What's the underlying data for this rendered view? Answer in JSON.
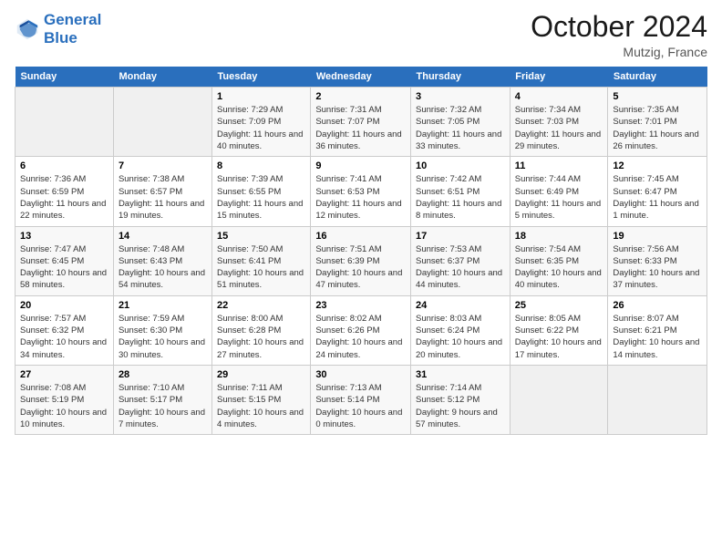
{
  "logo": {
    "line1": "General",
    "line2": "Blue"
  },
  "header": {
    "month": "October 2024",
    "location": "Mutzig, France"
  },
  "columns": [
    "Sunday",
    "Monday",
    "Tuesday",
    "Wednesday",
    "Thursday",
    "Friday",
    "Saturday"
  ],
  "weeks": [
    [
      {
        "day": "",
        "empty": true
      },
      {
        "day": "",
        "empty": true
      },
      {
        "day": "1",
        "sunrise": "7:29 AM",
        "sunset": "7:09 PM",
        "daylight": "11 hours and 40 minutes."
      },
      {
        "day": "2",
        "sunrise": "7:31 AM",
        "sunset": "7:07 PM",
        "daylight": "11 hours and 36 minutes."
      },
      {
        "day": "3",
        "sunrise": "7:32 AM",
        "sunset": "7:05 PM",
        "daylight": "11 hours and 33 minutes."
      },
      {
        "day": "4",
        "sunrise": "7:34 AM",
        "sunset": "7:03 PM",
        "daylight": "11 hours and 29 minutes."
      },
      {
        "day": "5",
        "sunrise": "7:35 AM",
        "sunset": "7:01 PM",
        "daylight": "11 hours and 26 minutes."
      }
    ],
    [
      {
        "day": "6",
        "sunrise": "7:36 AM",
        "sunset": "6:59 PM",
        "daylight": "11 hours and 22 minutes."
      },
      {
        "day": "7",
        "sunrise": "7:38 AM",
        "sunset": "6:57 PM",
        "daylight": "11 hours and 19 minutes."
      },
      {
        "day": "8",
        "sunrise": "7:39 AM",
        "sunset": "6:55 PM",
        "daylight": "11 hours and 15 minutes."
      },
      {
        "day": "9",
        "sunrise": "7:41 AM",
        "sunset": "6:53 PM",
        "daylight": "11 hours and 12 minutes."
      },
      {
        "day": "10",
        "sunrise": "7:42 AM",
        "sunset": "6:51 PM",
        "daylight": "11 hours and 8 minutes."
      },
      {
        "day": "11",
        "sunrise": "7:44 AM",
        "sunset": "6:49 PM",
        "daylight": "11 hours and 5 minutes."
      },
      {
        "day": "12",
        "sunrise": "7:45 AM",
        "sunset": "6:47 PM",
        "daylight": "11 hours and 1 minute."
      }
    ],
    [
      {
        "day": "13",
        "sunrise": "7:47 AM",
        "sunset": "6:45 PM",
        "daylight": "10 hours and 58 minutes."
      },
      {
        "day": "14",
        "sunrise": "7:48 AM",
        "sunset": "6:43 PM",
        "daylight": "10 hours and 54 minutes."
      },
      {
        "day": "15",
        "sunrise": "7:50 AM",
        "sunset": "6:41 PM",
        "daylight": "10 hours and 51 minutes."
      },
      {
        "day": "16",
        "sunrise": "7:51 AM",
        "sunset": "6:39 PM",
        "daylight": "10 hours and 47 minutes."
      },
      {
        "day": "17",
        "sunrise": "7:53 AM",
        "sunset": "6:37 PM",
        "daylight": "10 hours and 44 minutes."
      },
      {
        "day": "18",
        "sunrise": "7:54 AM",
        "sunset": "6:35 PM",
        "daylight": "10 hours and 40 minutes."
      },
      {
        "day": "19",
        "sunrise": "7:56 AM",
        "sunset": "6:33 PM",
        "daylight": "10 hours and 37 minutes."
      }
    ],
    [
      {
        "day": "20",
        "sunrise": "7:57 AM",
        "sunset": "6:32 PM",
        "daylight": "10 hours and 34 minutes."
      },
      {
        "day": "21",
        "sunrise": "7:59 AM",
        "sunset": "6:30 PM",
        "daylight": "10 hours and 30 minutes."
      },
      {
        "day": "22",
        "sunrise": "8:00 AM",
        "sunset": "6:28 PM",
        "daylight": "10 hours and 27 minutes."
      },
      {
        "day": "23",
        "sunrise": "8:02 AM",
        "sunset": "6:26 PM",
        "daylight": "10 hours and 24 minutes."
      },
      {
        "day": "24",
        "sunrise": "8:03 AM",
        "sunset": "6:24 PM",
        "daylight": "10 hours and 20 minutes."
      },
      {
        "day": "25",
        "sunrise": "8:05 AM",
        "sunset": "6:22 PM",
        "daylight": "10 hours and 17 minutes."
      },
      {
        "day": "26",
        "sunrise": "8:07 AM",
        "sunset": "6:21 PM",
        "daylight": "10 hours and 14 minutes."
      }
    ],
    [
      {
        "day": "27",
        "sunrise": "7:08 AM",
        "sunset": "5:19 PM",
        "daylight": "10 hours and 10 minutes."
      },
      {
        "day": "28",
        "sunrise": "7:10 AM",
        "sunset": "5:17 PM",
        "daylight": "10 hours and 7 minutes."
      },
      {
        "day": "29",
        "sunrise": "7:11 AM",
        "sunset": "5:15 PM",
        "daylight": "10 hours and 4 minutes."
      },
      {
        "day": "30",
        "sunrise": "7:13 AM",
        "sunset": "5:14 PM",
        "daylight": "10 hours and 0 minutes."
      },
      {
        "day": "31",
        "sunrise": "7:14 AM",
        "sunset": "5:12 PM",
        "daylight": "9 hours and 57 minutes."
      },
      {
        "day": "",
        "empty": true
      },
      {
        "day": "",
        "empty": true
      }
    ]
  ],
  "labels": {
    "sunrise": "Sunrise: ",
    "sunset": "Sunset: ",
    "daylight": "Daylight: "
  }
}
